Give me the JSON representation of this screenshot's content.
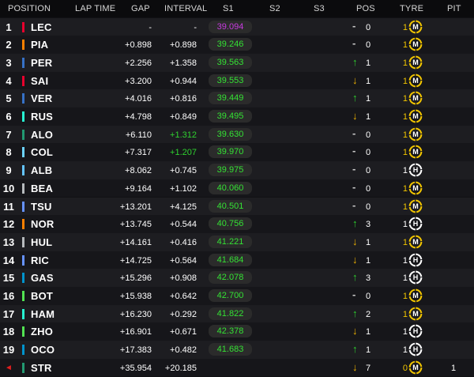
{
  "header": {
    "position": "POSITION",
    "lap_time": "LAP TIME",
    "gap": "GAP",
    "interval": "INTERVAL",
    "s1": "S1",
    "s2": "S2",
    "s3": "S3",
    "pos": "POS",
    "tyre": "TYRE",
    "pit": "PIT"
  },
  "colors": {
    "purple_sector": "#c83be0",
    "green_sector": "#34e234",
    "green_interval": "#2fd12f",
    "position_up": "#2fd12f",
    "position_down": "#f0b400",
    "tyre_medium": "#f0c400",
    "tyre_hard": "#ffffff"
  },
  "rows": [
    {
      "pos": "1",
      "team_color": "#e8002d",
      "driver": "LEC",
      "lap_time": "",
      "gap": "-",
      "interval": "-",
      "s1": "39.094",
      "s1_class": "purple",
      "s2": "",
      "s3": "",
      "change_dir": "same",
      "change_icon": "-",
      "change": "0",
      "tyre_age": "1",
      "tyre_compound": "M",
      "pit": ""
    },
    {
      "pos": "2",
      "team_color": "#ff8000",
      "driver": "PIA",
      "lap_time": "",
      "gap": "+0.898",
      "interval": "+0.898",
      "s1": "39.246",
      "s1_class": "green",
      "s2": "",
      "s3": "",
      "change_dir": "same",
      "change_icon": "-",
      "change": "0",
      "tyre_age": "1",
      "tyre_compound": "M",
      "pit": ""
    },
    {
      "pos": "3",
      "team_color": "#3671c6",
      "driver": "PER",
      "lap_time": "",
      "gap": "+2.256",
      "interval": "+1.358",
      "s1": "39.563",
      "s1_class": "green",
      "s2": "",
      "s3": "",
      "change_dir": "up",
      "change_icon": "↑",
      "change": "1",
      "tyre_age": "1",
      "tyre_compound": "M",
      "pit": ""
    },
    {
      "pos": "4",
      "team_color": "#e8002d",
      "driver": "SAI",
      "lap_time": "",
      "gap": "+3.200",
      "interval": "+0.944",
      "s1": "39.553",
      "s1_class": "green",
      "s2": "",
      "s3": "",
      "change_dir": "down",
      "change_icon": "↓",
      "change": "1",
      "tyre_age": "1",
      "tyre_compound": "M",
      "pit": ""
    },
    {
      "pos": "5",
      "team_color": "#3671c6",
      "driver": "VER",
      "lap_time": "",
      "gap": "+4.016",
      "interval": "+0.816",
      "s1": "39.449",
      "s1_class": "green",
      "s2": "",
      "s3": "",
      "change_dir": "up",
      "change_icon": "↑",
      "change": "1",
      "tyre_age": "1",
      "tyre_compound": "M",
      "pit": ""
    },
    {
      "pos": "6",
      "team_color": "#27f4d2",
      "driver": "RUS",
      "lap_time": "",
      "gap": "+4.798",
      "interval": "+0.849",
      "s1": "39.495",
      "s1_class": "green",
      "s2": "",
      "s3": "",
      "change_dir": "down",
      "change_icon": "↓",
      "change": "1",
      "tyre_age": "1",
      "tyre_compound": "M",
      "pit": ""
    },
    {
      "pos": "7",
      "team_color": "#229971",
      "driver": "ALO",
      "lap_time": "",
      "gap": "+6.110",
      "interval": "+1.312",
      "interval_class": "green",
      "s1": "39.630",
      "s1_class": "green",
      "s2": "",
      "s3": "",
      "change_dir": "same",
      "change_icon": "-",
      "change": "0",
      "tyre_age": "1",
      "tyre_compound": "M",
      "pit": ""
    },
    {
      "pos": "8",
      "team_color": "#6cd3ff",
      "driver": "COL",
      "lap_time": "",
      "gap": "+7.317",
      "interval": "+1.207",
      "interval_class": "green",
      "s1": "39.970",
      "s1_class": "green",
      "s2": "",
      "s3": "",
      "change_dir": "same",
      "change_icon": "-",
      "change": "0",
      "tyre_age": "1",
      "tyre_compound": "M",
      "pit": ""
    },
    {
      "pos": "9",
      "team_color": "#64c4ff",
      "driver": "ALB",
      "lap_time": "",
      "gap": "+8.062",
      "interval": "+0.745",
      "s1": "39.975",
      "s1_class": "green",
      "s2": "",
      "s3": "",
      "change_dir": "same",
      "change_icon": "-",
      "change": "0",
      "tyre_age": "1",
      "tyre_compound": "H",
      "pit": ""
    },
    {
      "pos": "10",
      "team_color": "#b6babd",
      "driver": "BEA",
      "lap_time": "",
      "gap": "+9.164",
      "interval": "+1.102",
      "s1": "40.060",
      "s1_class": "green",
      "s2": "",
      "s3": "",
      "change_dir": "same",
      "change_icon": "-",
      "change": "0",
      "tyre_age": "1",
      "tyre_compound": "M",
      "pit": ""
    },
    {
      "pos": "11",
      "team_color": "#6692ff",
      "driver": "TSU",
      "lap_time": "",
      "gap": "+13.201",
      "interval": "+4.125",
      "s1": "40.501",
      "s1_class": "green",
      "s2": "",
      "s3": "",
      "change_dir": "same",
      "change_icon": "-",
      "change": "0",
      "tyre_age": "1",
      "tyre_compound": "M",
      "pit": ""
    },
    {
      "pos": "12",
      "team_color": "#ff8000",
      "driver": "NOR",
      "lap_time": "",
      "gap": "+13.745",
      "interval": "+0.544",
      "s1": "40.756",
      "s1_class": "green",
      "s2": "",
      "s3": "",
      "change_dir": "up",
      "change_icon": "↑",
      "change": "3",
      "tyre_age": "1",
      "tyre_compound": "H",
      "pit": ""
    },
    {
      "pos": "13",
      "team_color": "#b6babd",
      "driver": "HUL",
      "lap_time": "",
      "gap": "+14.161",
      "interval": "+0.416",
      "s1": "41.221",
      "s1_class": "green",
      "s2": "",
      "s3": "",
      "change_dir": "down",
      "change_icon": "↓",
      "change": "1",
      "tyre_age": "1",
      "tyre_compound": "M",
      "pit": ""
    },
    {
      "pos": "14",
      "team_color": "#6692ff",
      "driver": "RIC",
      "lap_time": "",
      "gap": "+14.725",
      "interval": "+0.564",
      "s1": "41.684",
      "s1_class": "green",
      "s2": "",
      "s3": "",
      "change_dir": "down",
      "change_icon": "↓",
      "change": "1",
      "tyre_age": "1",
      "tyre_compound": "H",
      "pit": ""
    },
    {
      "pos": "15",
      "team_color": "#0093cc",
      "driver": "GAS",
      "lap_time": "",
      "gap": "+15.296",
      "interval": "+0.908",
      "s1": "42.078",
      "s1_class": "green",
      "s2": "",
      "s3": "",
      "change_dir": "up",
      "change_icon": "↑",
      "change": "3",
      "tyre_age": "1",
      "tyre_compound": "H",
      "pit": ""
    },
    {
      "pos": "16",
      "team_color": "#52e252",
      "driver": "BOT",
      "lap_time": "",
      "gap": "+15.938",
      "interval": "+0.642",
      "s1": "42.700",
      "s1_class": "green",
      "s2": "",
      "s3": "",
      "change_dir": "same",
      "change_icon": "-",
      "change": "0",
      "tyre_age": "1",
      "tyre_compound": "M",
      "pit": ""
    },
    {
      "pos": "17",
      "team_color": "#27f4d2",
      "driver": "HAM",
      "lap_time": "",
      "gap": "+16.230",
      "interval": "+0.292",
      "s1": "41.822",
      "s1_class": "green",
      "s2": "",
      "s3": "",
      "change_dir": "up",
      "change_icon": "↑",
      "change": "2",
      "tyre_age": "1",
      "tyre_compound": "M",
      "pit": ""
    },
    {
      "pos": "18",
      "team_color": "#52e252",
      "driver": "ZHO",
      "lap_time": "",
      "gap": "+16.901",
      "interval": "+0.671",
      "s1": "42.378",
      "s1_class": "green",
      "s2": "",
      "s3": "",
      "change_dir": "down",
      "change_icon": "↓",
      "change": "1",
      "tyre_age": "1",
      "tyre_compound": "H",
      "pit": ""
    },
    {
      "pos": "19",
      "team_color": "#0093cc",
      "driver": "OCO",
      "lap_time": "",
      "gap": "+17.383",
      "interval": "+0.482",
      "s1": "41.683",
      "s1_class": "green",
      "s2": "",
      "s3": "",
      "change_dir": "up",
      "change_icon": "↑",
      "change": "1",
      "tyre_age": "1",
      "tyre_compound": "H",
      "pit": ""
    },
    {
      "pos": "",
      "pos_flag": "◄",
      "team_color": "#229971",
      "driver": "STR",
      "lap_time": "",
      "gap": "+35.954",
      "interval": "+20.185",
      "s1": "",
      "s1_class": "",
      "s2": "",
      "s3": "",
      "change_dir": "down",
      "change_icon": "↓",
      "change": "7",
      "tyre_age": "0",
      "tyre_compound": "M",
      "pit": "1"
    }
  ]
}
